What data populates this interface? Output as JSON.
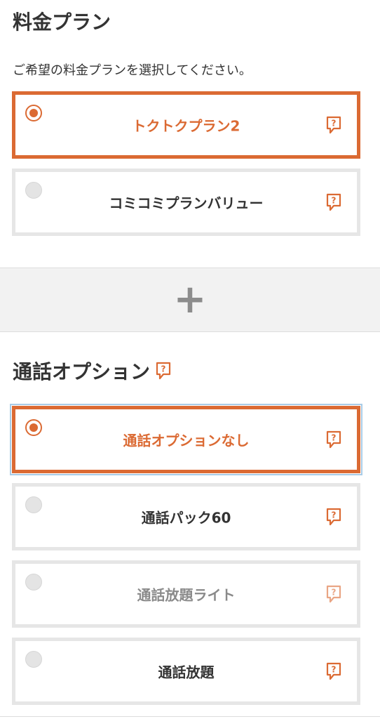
{
  "plan_section": {
    "title": "料金プラン",
    "instruction": "ご希望の料金プランを選択してください。",
    "options": [
      {
        "label": "トクトクプラン2",
        "selected": true
      },
      {
        "label": "コミコミプランバリュー",
        "selected": false
      }
    ]
  },
  "combiner": {
    "symbol": "+"
  },
  "call_section": {
    "title": "通話オプション",
    "options": [
      {
        "label": "通話オプションなし",
        "selected": true
      },
      {
        "label": "通話パック60",
        "selected": false
      },
      {
        "label": "通話放題ライト",
        "selected": false
      },
      {
        "label": "通話放題",
        "selected": false
      }
    ]
  },
  "icons": {
    "help": "question-speech-bubble-icon",
    "radio": "radio-icon"
  },
  "colors": {
    "accent": "#db6a33",
    "border": "#e6e6e6",
    "band": "#f2f2f2"
  }
}
